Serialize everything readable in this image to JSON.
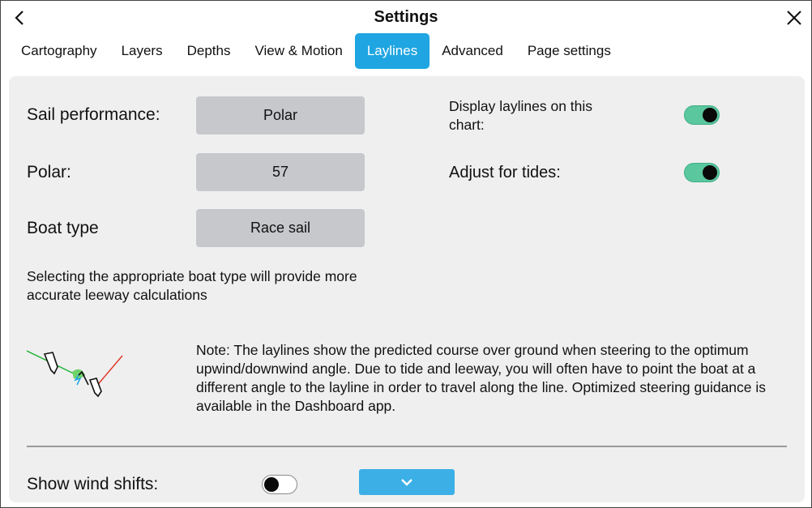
{
  "header": {
    "title": "Settings",
    "back_icon": "chevron-left-icon",
    "close_icon": "close-icon"
  },
  "tabs": [
    {
      "label": "Cartography",
      "active": false
    },
    {
      "label": "Layers",
      "active": false
    },
    {
      "label": "Depths",
      "active": false
    },
    {
      "label": "View & Motion",
      "active": false
    },
    {
      "label": "Laylines",
      "active": true
    },
    {
      "label": "Advanced",
      "active": false
    },
    {
      "label": "Page settings",
      "active": false
    }
  ],
  "settings": {
    "sail_performance": {
      "label": "Sail performance:",
      "value": "Polar"
    },
    "polar": {
      "label": "Polar:",
      "value": "57"
    },
    "boat_type": {
      "label": "Boat type",
      "value": "Race sail"
    },
    "boat_type_help": "Selecting the appropriate boat type will provide more accurate leeway calculations",
    "display_laylines": {
      "label": "Display laylines on this chart:",
      "on": true
    },
    "adjust_for_tides": {
      "label": "Adjust for tides:",
      "on": true
    },
    "note": "Note:  The laylines show the predicted course over ground when steering to the optimum upwind/downwind angle. Due to tide and leeway, you will often have to point the boat at a different angle to the layline in order to travel along the line. Optimized steering guidance is available in the Dashboard app.",
    "show_wind_shifts": {
      "label": "Show wind shifts:",
      "on": false
    }
  },
  "colors": {
    "accent": "#1ea5e2",
    "toggle_on": "#5ac79f",
    "panel_bg": "#efefef",
    "button_bg": "#c6c8cc",
    "layline_green": "#22b33a",
    "layline_red": "#e0392b"
  },
  "icons": {
    "dropdown": "chevron-down-icon",
    "diagram": "laylines-diagram-icon"
  }
}
